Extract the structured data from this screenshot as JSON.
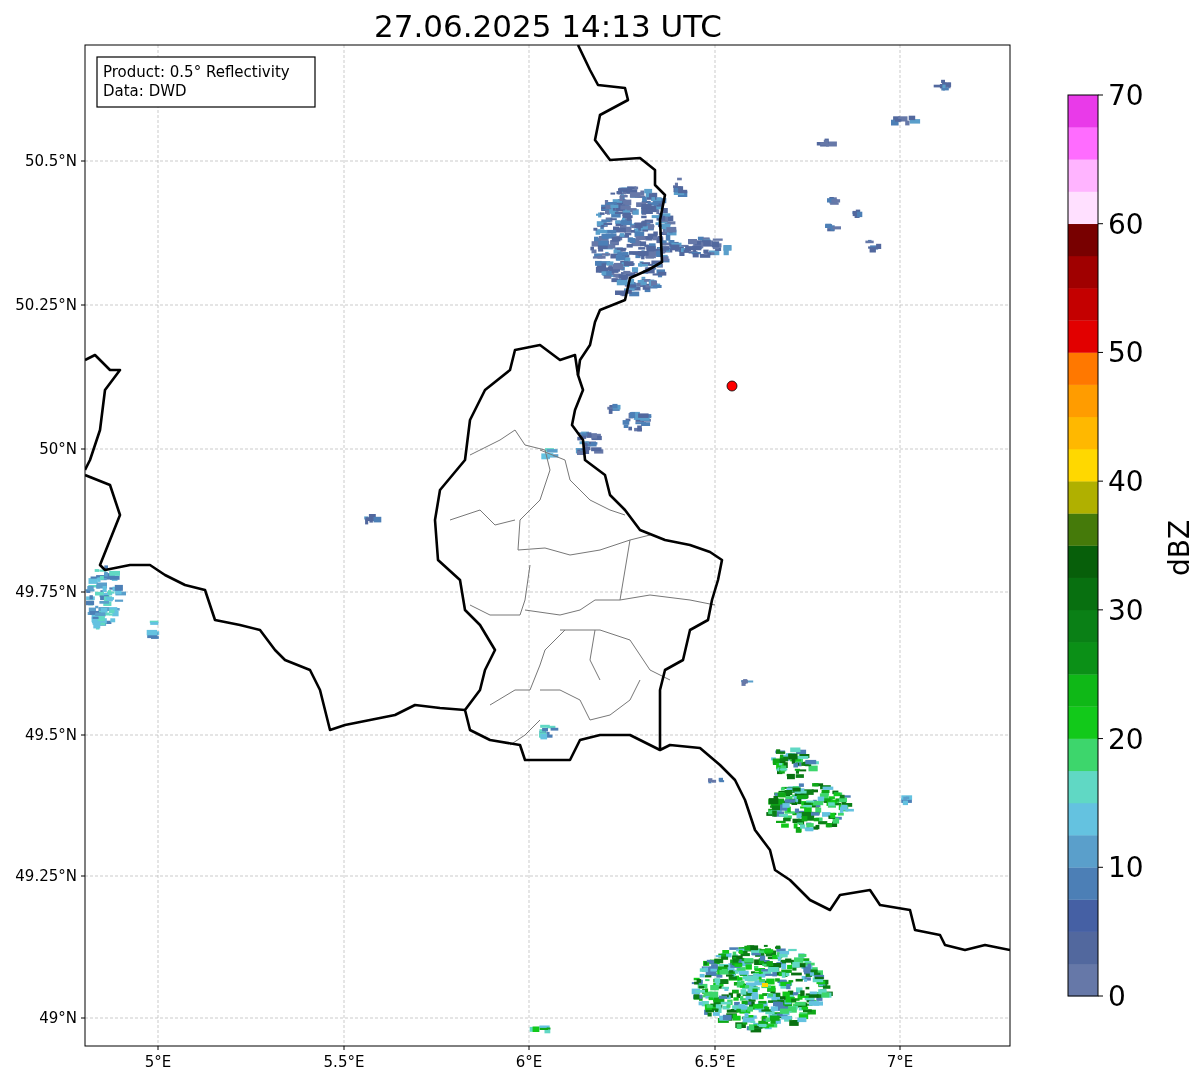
{
  "title": "27.06.2025 14:13 UTC",
  "info_box": [
    "Product: 0.5° Reflectivity",
    "Data: DWD"
  ],
  "map": {
    "x_ticks": [
      "5°E",
      "5.5°E",
      "6°E",
      "6.5°E",
      "7°E"
    ],
    "y_ticks": [
      "50.5°N",
      "50.25°N",
      "50°N",
      "49.75°N",
      "49.5°N",
      "49.25°N",
      "49°N"
    ]
  },
  "colorbar": {
    "label": "dBZ",
    "ticks": [
      "70",
      "60",
      "50",
      "40",
      "30",
      "20",
      "10",
      "0"
    ],
    "levels": [
      {
        "color": "#6678a8"
      },
      {
        "color": "#52689e"
      },
      {
        "color": "#4560a4"
      },
      {
        "color": "#4c7fb6"
      },
      {
        "color": "#5a9fcb"
      },
      {
        "color": "#64c2e0"
      },
      {
        "color": "#60d8c4"
      },
      {
        "color": "#3dd66c"
      },
      {
        "color": "#12c91a"
      },
      {
        "color": "#0fb817"
      },
      {
        "color": "#0b9017"
      },
      {
        "color": "#0a8016"
      },
      {
        "color": "#087010"
      },
      {
        "color": "#075f0a"
      },
      {
        "color": "#457a0a"
      },
      {
        "color": "#b0b000"
      },
      {
        "color": "#ffd800"
      },
      {
        "color": "#ffb800"
      },
      {
        "color": "#ff9c00"
      },
      {
        "color": "#ff7800"
      },
      {
        "color": "#e20000"
      },
      {
        "color": "#c40000"
      },
      {
        "color": "#a00000"
      },
      {
        "color": "#780000"
      },
      {
        "color": "#ffe0ff"
      },
      {
        "color": "#ffb4ff"
      },
      {
        "color": "#ff6cff"
      },
      {
        "color": "#e93ae9"
      }
    ]
  }
}
